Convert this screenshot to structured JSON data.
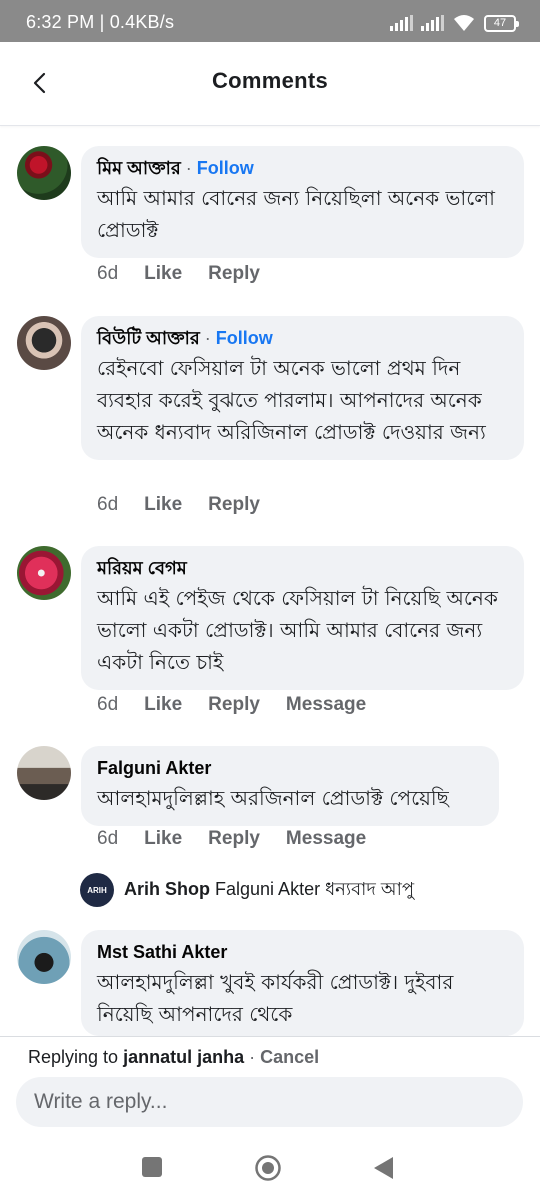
{
  "status_bar": {
    "time_speed": "6:32 PM | 0.4KB/s",
    "battery": "47"
  },
  "header": {
    "title": "Comments",
    "back_icon": "chevron-left-icon"
  },
  "comments": [
    {
      "name": "মিম আক্তার",
      "follow": "Follow",
      "text": "আমি আমার বোনের জন্য নিয়েছিলা অনেক ভালো প্রোডাক্ট",
      "time": "6d",
      "like": "Like",
      "reply": "Reply"
    },
    {
      "name": "বিউটি আক্তার",
      "follow": "Follow",
      "text": "রেইনবো ফেসিয়াল টা অনেক ভালো প্রথম দিন ব্যবহার করেই বুঝতে পারলাম। আপনাদের অনেক অনেক ধন্যবাদ অরিজিনাল প্রোডাক্ট দেওয়ার জন্য",
      "time": "6d",
      "like": "Like",
      "reply": "Reply"
    },
    {
      "name": "মরিয়ম বেগম",
      "text": "আমি এই পেইজ থেকে ফেসিয়াল টা নিয়েছি অনেক ভালো একটা প্রোডাক্ট। আমি আমার বোনের জন্য একটা নিতে চাই",
      "time": "6d",
      "like": "Like",
      "reply": "Reply",
      "message": "Message"
    },
    {
      "name": "Falguni Akter",
      "text": "আলহামদুলিল্লাহ অরজিনাল প্রোডাক্ট পেয়েছি",
      "time": "6d",
      "like": "Like",
      "reply": "Reply",
      "message": "Message"
    },
    {
      "name": "Mst Sathi Akter",
      "text": "আলহামদুলিল্লা খুবই কার্যকরী প্রোডাক্ট। দুইবার নিয়েছি আপনাদের থেকে"
    }
  ],
  "page_reply": {
    "logo_text": "ARIH",
    "name": "Arih Shop",
    "text": "Falguni Akter ধন্যবাদ আপু"
  },
  "composer": {
    "replying_prefix": "Replying to",
    "replying_name": "jannatul janha",
    "separator": "·",
    "cancel": "Cancel",
    "placeholder": "Write a reply..."
  },
  "nav": {
    "recent": "square-icon",
    "home": "circle-icon",
    "back": "triangle-back-icon"
  },
  "colors": {
    "accent": "#1877f2",
    "bubble": "#f0f2f5",
    "muted": "#65676b"
  }
}
